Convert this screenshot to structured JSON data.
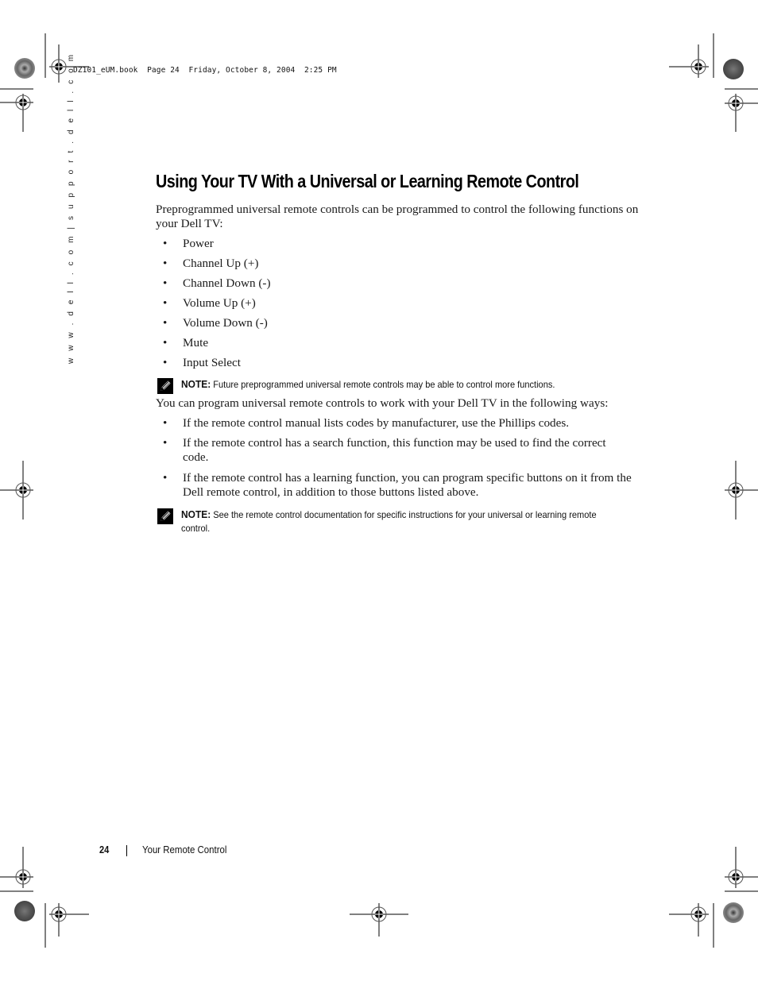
{
  "print_slug": "DZ101_eUM.book  Page 24  Friday, October 8, 2004  2:25 PM",
  "sidebar_url": "w w w . d e l l . c o m  |  s u p p o r t . d e l l . c o m",
  "title": "Using Your TV With a Universal or Learning Remote Control",
  "intro": "Preprogrammed universal remote controls can be programmed to control the following functions on your Dell TV:",
  "functions": [
    "Power",
    "Channel Up (+)",
    "Channel Down (-)",
    "Volume Up (+)",
    "Volume Down (-)",
    "Mute",
    "Input Select"
  ],
  "note1": {
    "icon": "pencil-note-icon",
    "label": "NOTE:",
    "text": " Future preprogrammed universal remote controls may be able to control more functions."
  },
  "ways_intro": "You can program universal remote controls to work with your Dell TV in the following ways:",
  "ways": [
    "If the remote control manual lists codes by manufacturer, use the Phillips codes.",
    "If the remote control has a search function, this function may be used to find the correct code.",
    "If the remote control has a learning function, you can program specific buttons on it from the Dell remote control, in addition to those buttons listed above."
  ],
  "note2": {
    "icon": "pencil-note-icon",
    "label": "NOTE:",
    "text": " See the remote control documentation for specific instructions for your universal or learning remote control."
  },
  "footer": {
    "page_number": "24",
    "section_title": "Your Remote Control"
  },
  "bullet_glyph": "•"
}
